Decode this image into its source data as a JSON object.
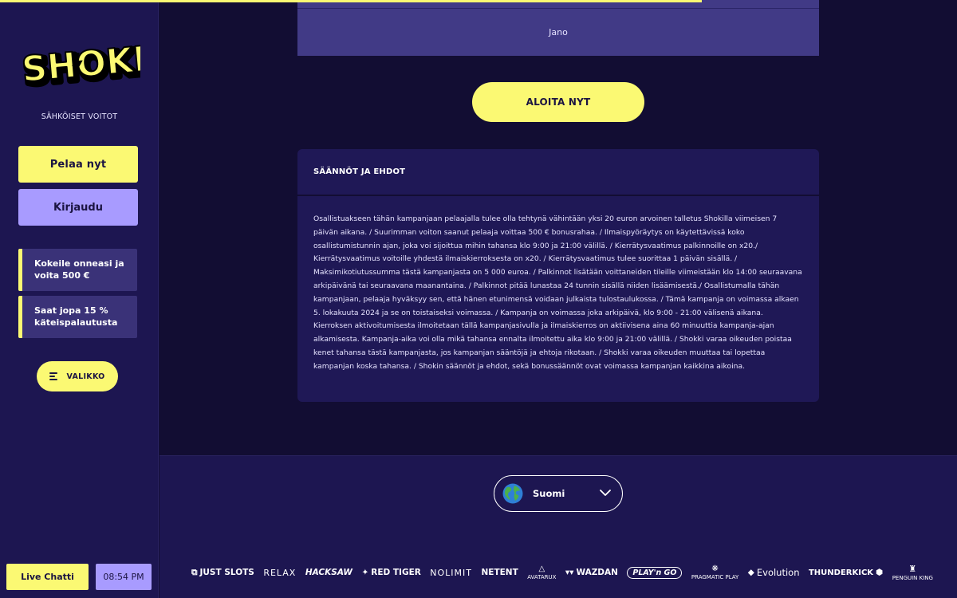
{
  "brand": {
    "logo_text": "SHOKKI",
    "tagline": "SÄHKÖISET VOITOT",
    "accent_color": "#fbf973",
    "secondary_color": "#a89bff",
    "background_color": "#120d33"
  },
  "sidebar": {
    "play_label": "Pelaa nyt",
    "login_label": "Kirjaudu",
    "promos": [
      {
        "label": "Kokeile onneasi ja voita 500 €"
      },
      {
        "label": "Saat jopa 15 % käteispalautusta"
      }
    ],
    "menu_label": "VALIKKO",
    "menu_icon": "hamburger-menu-icon",
    "chat_label": "Live Chatti",
    "clock": "08:54 PM"
  },
  "main": {
    "table_cell": "Jano",
    "cta_label": "ALOITA NYT",
    "terms": {
      "heading": "SÄÄNNÖT JA EHDOT",
      "body": "Osallistuakseen tähän kampanjaan pelaajalla tulee olla tehtynä vähintään yksi 20 euron arvoinen talletus Shokilla viimeisen 7 päivän aikana. / Suurimman voiton saanut pelaaja voittaa 500 € bonusrahaa. / Ilmaispyöräytys on käytettävissä koko osallistumistunnin ajan, joka voi sijoittua mihin tahansa klo 9:00 ja 21:00 välillä. / Kierrätysvaatimus palkinnoille on x20./ Kierrätysvaatimus voitoille yhdestä ilmaiskierroksesta on x20. / Kierrätysvaatimus tulee suorittaa 1 päivän sisällä. / Maksimikotiutussumma tästä kampanjasta on 5 000 euroa. / Palkinnot lisätään voittaneiden tileille viimeistään klo 14:00 seuraavana arkipäivänä tai seuraavana maanantaina. / Palkinnot pitää lunastaa 24 tunnin sisällä niiden lisäämisestä./ Osallistumalla tähän kampanjaan, pelaaja hyväksyy sen, että hänen etunimensä voidaan julkaista tulostaulukossa. / Tämä kampanja on voimassa alkaen 5. lokakuuta 2024 ja se on toistaiseksi voimassa. / Kampanja on voimassa joka arkipäivä, klo 9:00 - 21:00 välisenä aikana. Kierroksen aktivoitumisesta ilmoitetaan tällä kampanjasivulla ja ilmaiskierros on aktiivisena aina 60 minuuttia kampanja-ajan alkamisesta. Kampanja-aika voi olla mikä tahansa ennalta ilmoitettu aika klo 9:00 ja 21:00 välillä. / Shokki varaa oikeuden poistaa kenet tahansa tästä kampanjasta, jos kampanjan sääntöjä ja ehtoja rikotaan. / Shokki varaa oikeuden muuttaa tai lopettaa kampanjan koska tahansa. / Shokin säännöt ja ehdot, sekä bonussäännöt ovat voimassa kampanjan kaikkina aikoina."
    }
  },
  "footer": {
    "language": "Suomi",
    "language_icon": "globe-icon",
    "providers": [
      "JUST SLOTS",
      "RELAX",
      "HACKSAW",
      "RED TIGER",
      "NOLIMIT",
      "NETENT",
      "AVATARUX",
      "WAZDAN",
      "PLAY'n GO",
      "PRAGMATIC PLAY",
      "Evolution",
      "THUNDERKICK",
      "PENGUIN KING"
    ]
  }
}
